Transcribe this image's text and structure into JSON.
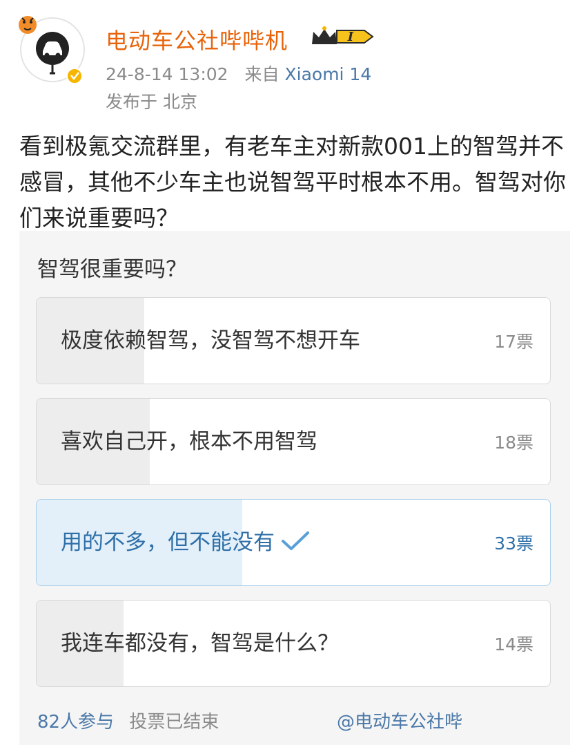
{
  "post": {
    "author": "电动车公社哔哔机",
    "level_badge": "I",
    "time": "24-8-14 13:02",
    "source_prefix": "来自",
    "device": "Xiaomi 14",
    "location": "发布于 北京",
    "text": "看到极氪交流群里，有老车主对新款001上的智驾并不感冒，其他不少车主也说智驾平时根本不用。智驾对你们来说重要吗？"
  },
  "poll": {
    "question": "智驾很重要吗？",
    "options": [
      {
        "label": "极度依赖智驾，没智驾不想开车",
        "votes": "17票",
        "share": 0.21,
        "selected": false
      },
      {
        "label": "喜欢自己开，根本不用智驾",
        "votes": "18票",
        "share": 0.22,
        "selected": false
      },
      {
        "label": "用的不多，但不能没有",
        "votes": "33票",
        "share": 0.4,
        "selected": true
      },
      {
        "label": "我连车都没有，智驾是什么？",
        "votes": "14票",
        "share": 0.17,
        "selected": false
      }
    ],
    "participants": "82人参与",
    "status": "投票已结束",
    "watermark": "@电动车公社哔"
  },
  "colors": {
    "author": "#e8630a",
    "link": "#4a78a8",
    "selected_fill": "#e3f0fa",
    "bar_fill": "#ededed"
  }
}
